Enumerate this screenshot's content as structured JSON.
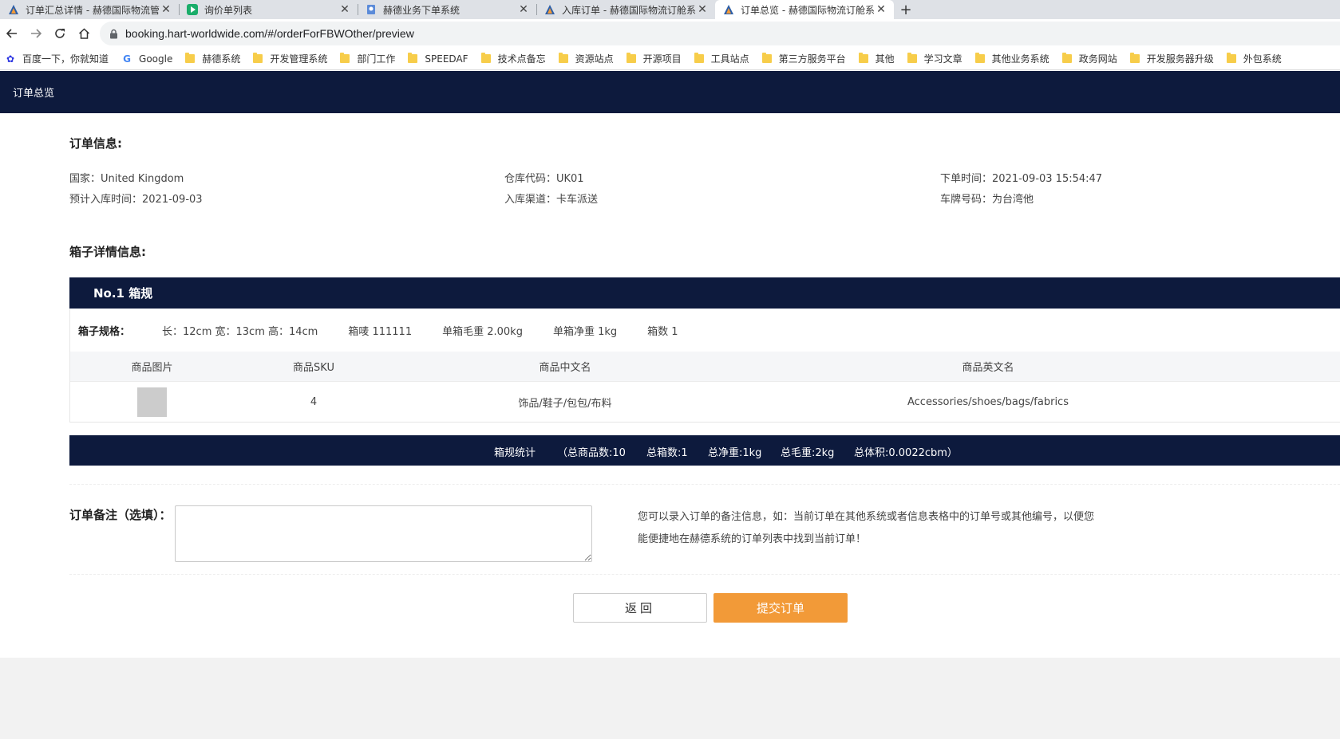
{
  "browser": {
    "tabs": [
      {
        "title": "订单汇总详情 - 赫德国际物流管理",
        "icon": "hart-logo-icon"
      },
      {
        "title": "询价单列表",
        "icon": "green-play-icon"
      },
      {
        "title": "赫德业务下单系统",
        "icon": "document-icon"
      },
      {
        "title": "入库订单 - 赫德国际物流订舱系统",
        "icon": "hart-logo-icon"
      },
      {
        "title": "订单总览 - 赫德国际物流订舱系统",
        "icon": "hart-logo-icon"
      }
    ],
    "url": "booking.hart-worldwide.com/#/orderForFBWOther/preview",
    "bookmarks": [
      "百度一下，你就知道",
      "Google",
      "赫德系统",
      "开发管理系统",
      "部门工作",
      "SPEEDAF",
      "技术点备忘",
      "资源站点",
      "开源项目",
      "工具站点",
      "第三方服务平台",
      "其他",
      "学习文章",
      "其他业务系统",
      "政务网站",
      "开发服务器升级",
      "外包系统"
    ]
  },
  "app": {
    "header_title": "订单总览"
  },
  "order_info": {
    "title": "订单信息:",
    "country": "国家：United Kingdom",
    "warehouse_code": "仓库代码：UK01",
    "order_time": "下单时间：2021-09-03 15:54:47",
    "expected_date": "预计入库时间：2021-09-03",
    "channel": "入库渠道：卡车派送",
    "plate": "车牌号码：为台湾他"
  },
  "box_info": {
    "title": "箱子详情信息:",
    "box_title": "No.1 箱规",
    "spec_label": "箱子规格：",
    "dimensions": "长：12cm 宽：13cm 高：14cm",
    "mark": "箱唛 111111",
    "gross_weight": "单箱毛重 2.00kg",
    "net_weight": "单箱净重 1kg",
    "count": "箱数 1",
    "columns": [
      "商品图片",
      "商品SKU",
      "商品中文名",
      "商品英文名"
    ],
    "rows": [
      {
        "sku": "4",
        "name_cn": "饰品/鞋子/包包/布料",
        "name_en": "Accessories/shoes/bags/fabrics"
      }
    ]
  },
  "summary": {
    "label": "箱规统计",
    "total_items": "（总商品数:10",
    "total_boxes": "总箱数:1",
    "total_net": "总净重:1kg",
    "total_gross": "总毛重:2kg",
    "total_volume": "总体积:0.0022cbm）"
  },
  "remark": {
    "label": "订单备注（选填）：",
    "value": "",
    "tip_line1": "您可以录入订单的备注信息，如：当前订单在其他系统或者信息表格中的订单号或其他编号，以便您",
    "tip_line2": "能便捷地在赫德系统的订单列表中找到当前订单！"
  },
  "actions": {
    "back": "返回",
    "submit": "提交订单"
  },
  "colors": {
    "navy": "#0d1a3d",
    "accent": "#f29a38"
  }
}
